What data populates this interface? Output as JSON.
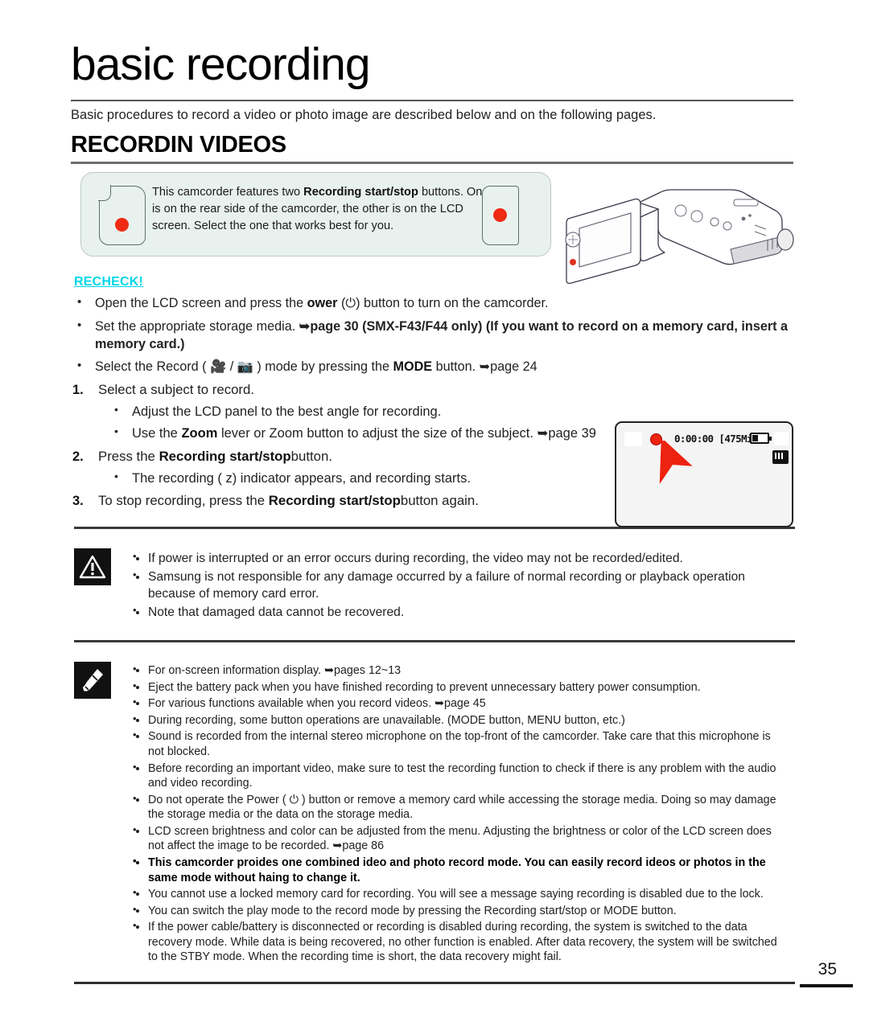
{
  "header": {
    "title": "basic recording",
    "intro": "Basic procedures to record a video or photo image are described below and on the following pages.",
    "section_title": "RECORDIN VIDEOS"
  },
  "callout": {
    "text_part1": "This camcorder features two ",
    "text_bold": "Recording start/stop",
    "text_part2": " buttons. One is on the rear side of the camcorder, the other is on the LCD screen. Select the one that works best for you.",
    "button_color": "#ef2b14",
    "background": "#e9f1ef"
  },
  "recheck": {
    "label": "RECHECK!",
    "color": "#00d6e8",
    "items": [
      {
        "pre": "Open the LCD screen and press the ",
        "bold": "ower",
        "post": "  (⏻) button to turn on the camcorder."
      },
      {
        "pre": "Set the appropriate storage media. ",
        "bold": "",
        "post": "➥page 30 (SMX-F43/F44 only) (If you want to record on a memory card, insert a memory card.)"
      },
      {
        "pre": "Select the Record ( 🎥 / 📷 ) mode by pressing the ",
        "bold": "MODE",
        "post": " button. ➥page 24"
      }
    ]
  },
  "steps": [
    {
      "num": "1.",
      "text": "Select a subject to record.",
      "subs": [
        {
          "pre": "Adjust the LCD panel to the best angle for recording.",
          "bold": "",
          "post": ""
        },
        {
          "pre": "Use the ",
          "bold": "Zoom",
          "post": " lever or Zoom button to adjust the size of the subject. ➥page 39"
        }
      ]
    },
    {
      "num": "2.",
      "pre": "Press the ",
      "bold": "Recording start/stop",
      "post": "button.",
      "subs": [
        {
          "pre": "The recording ( z) indicator appears, and recording starts.",
          "bold": "",
          "post": ""
        }
      ]
    },
    {
      "num": "3.",
      "pre": "To stop recording, press the ",
      "bold": "Recording start/stop",
      "post": "button again.",
      "subs": []
    }
  ],
  "lcd": {
    "timecode": "0:00:00 [475Min]",
    "record_dot_color": "#ee2211",
    "cursor_color": "#ee2211"
  },
  "warning": {
    "icon": "warning-triangle-icon",
    "items": [
      "If power is interrupted or an error occurs during recording, the video may not be recorded/edited.",
      "Samsung is not responsible for any damage occurred by a failure of normal recording or playback operation because of memory card error.",
      "Note that damaged data cannot be recovered."
    ]
  },
  "notes": {
    "icon": "note-pen-icon",
    "items": [
      {
        "text": "For on-screen information display. ➥pages 12~13",
        "bold": false
      },
      {
        "text": "Eject the battery pack when you have finished recording to prevent unnecessary battery power consumption.",
        "bold": false
      },
      {
        "text": "For various functions available when you record videos. ➥page 45",
        "bold": false
      },
      {
        "text": "During recording, some button operations are unavailable. (MODE button, MENU button, etc.)",
        "bold": false
      },
      {
        "text": "Sound is recorded from the internal stereo microphone on the top-front of the camcorder. Take care that this microphone is not blocked.",
        "bold": false
      },
      {
        "text": "Before recording an important video, make sure to test the recording function to check if there is any problem with the audio and video recording.",
        "bold": false
      },
      {
        "text": "Do not operate the Power ( ⏻ ) button or remove a memory card while accessing the storage media. Doing so may damage the storage media or the data on the storage media.",
        "bold": false
      },
      {
        "text": "LCD screen brightness and color can be adjusted from the menu. Adjusting the brightness or color of the LCD screen does not affect the image to be recorded. ➥page 86",
        "bold": false
      },
      {
        "text": "This camcorder proides one combined ideo and photo record mode. You can easily record ideos or photos in the same mode without haing to change it.",
        "bold": true
      },
      {
        "text": "You cannot use a locked memory card for recording. You will see a message saying recording is disabled due to the lock.",
        "bold": false
      },
      {
        "text": "You can switch the play mode to the record mode by pressing the Recording start/stop or MODE button.",
        "bold": false
      },
      {
        "text": "If the power cable/battery is disconnected or recording is disabled during recording, the system is switched to the data recovery mode. While data is being recovered, no other function is enabled. After data recovery, the system will be switched to the STBY mode. When the recording time is short, the data recovery might fail.",
        "bold": false
      }
    ]
  },
  "footer": {
    "page_number": "35"
  }
}
